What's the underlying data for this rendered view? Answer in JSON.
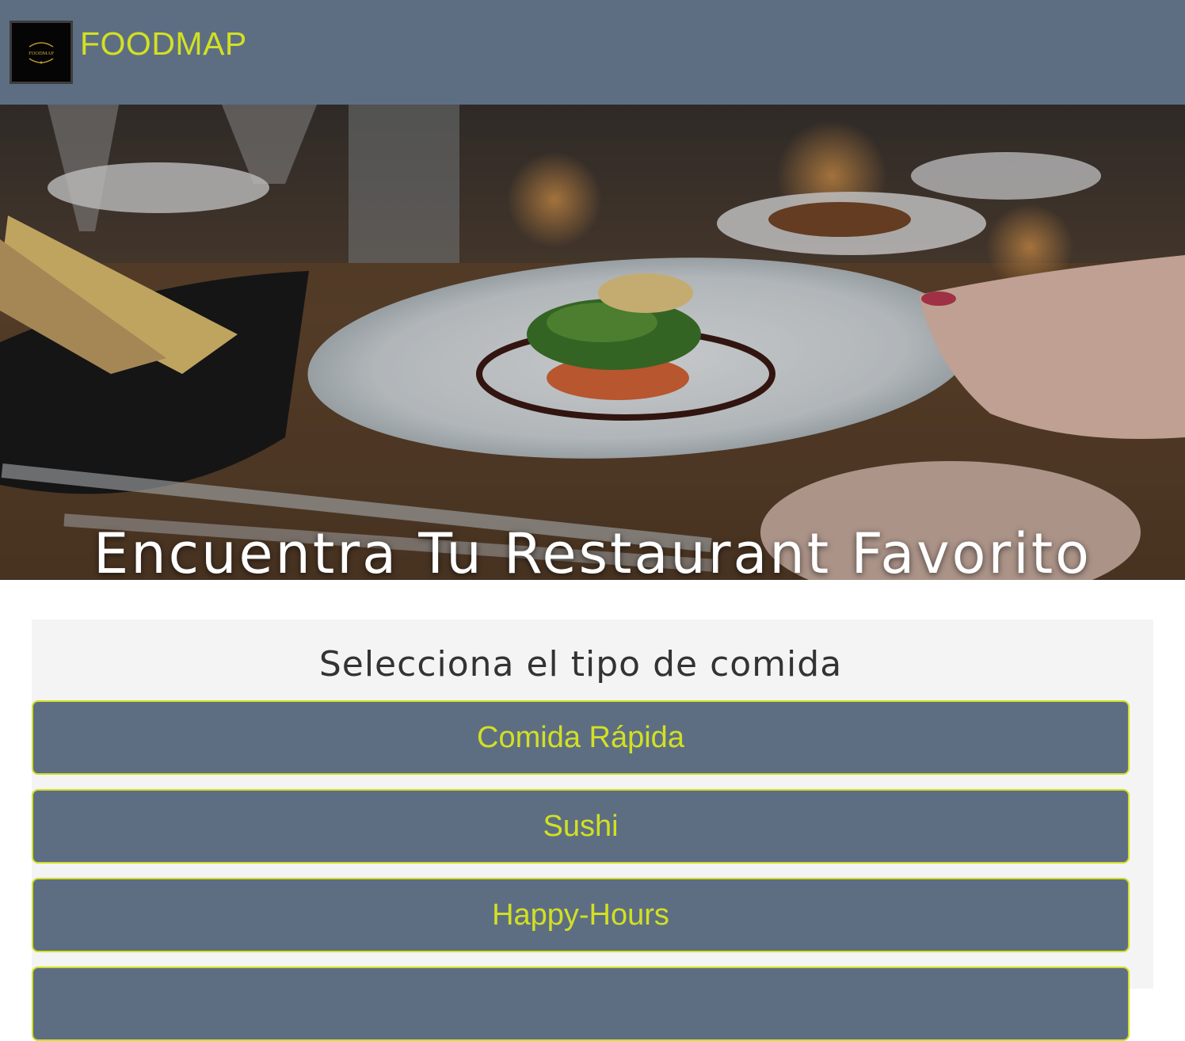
{
  "colors": {
    "header_bg": "#5d6e83",
    "accent": "#d2e023",
    "panel_bg": "#f4f4f4",
    "button_bg": "#5d6e83"
  },
  "header": {
    "logo_icon": "foodmap-logo-icon",
    "brand": "FOODMAP",
    "logo_text": "FOODMAP"
  },
  "hero": {
    "image": "restaurant-dish-photo",
    "title": "Encuentra Tu Restaurant Favorito"
  },
  "categories": {
    "title": "Selecciona el tipo de comida",
    "items": [
      {
        "label": "Comida Rápida"
      },
      {
        "label": "Sushi"
      },
      {
        "label": "Happy-Hours"
      },
      {
        "label": ""
      }
    ]
  }
}
